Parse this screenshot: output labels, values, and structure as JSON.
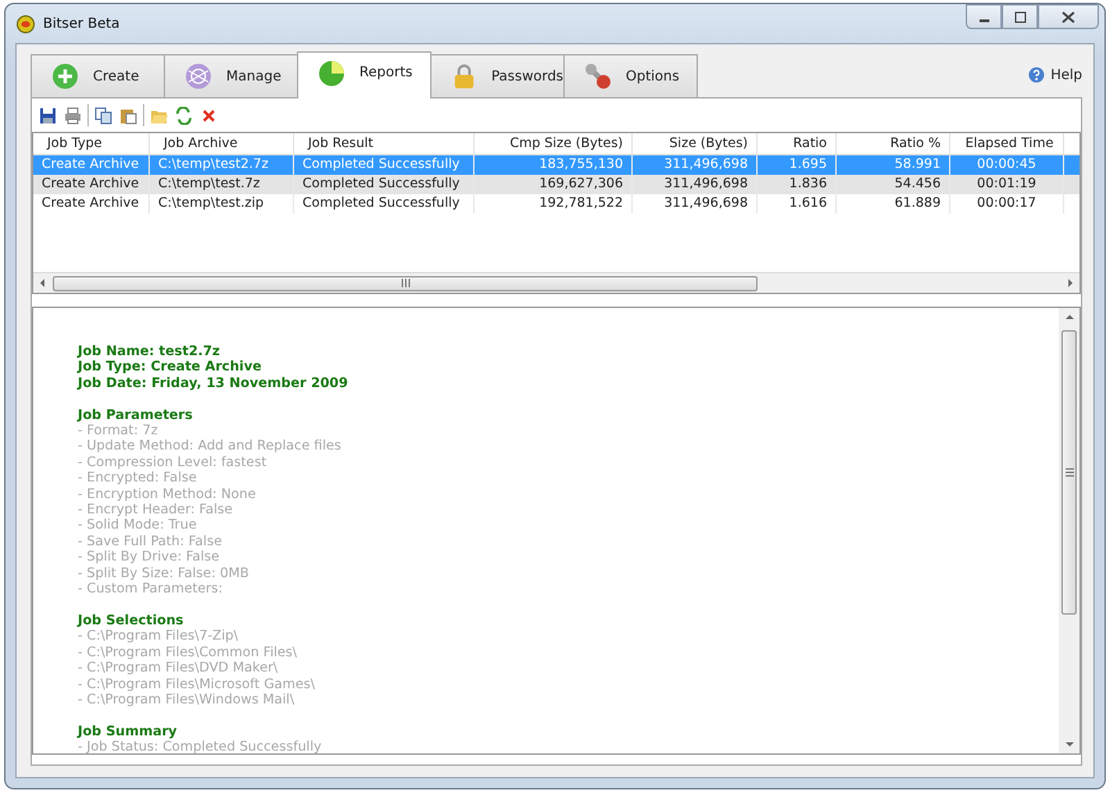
{
  "window": {
    "title": "Bitser Beta"
  },
  "tabs": [
    {
      "label": "Create",
      "selected": false
    },
    {
      "label": "Manage",
      "selected": false
    },
    {
      "label": "Reports",
      "selected": true
    },
    {
      "label": "Passwords",
      "selected": false
    },
    {
      "label": "Options",
      "selected": false
    }
  ],
  "help": {
    "label": "Help"
  },
  "table": {
    "columns": [
      "Job Type",
      "Job Archive",
      "Job Result",
      "Cmp Size (Bytes)",
      "Size (Bytes)",
      "Ratio",
      "Ratio %",
      "Elapsed Time"
    ],
    "rows": [
      {
        "selected": true,
        "hovered": false,
        "cells": [
          "Create Archive",
          "C:\\temp\\test2.7z",
          "Completed Successfully",
          "183,755,130",
          "311,496,698",
          "1.695",
          "58.991",
          "00:00:45"
        ]
      },
      {
        "selected": false,
        "hovered": true,
        "cells": [
          "Create Archive",
          "C:\\temp\\test.7z",
          "Completed Successfully",
          "169,627,306",
          "311,496,698",
          "1.836",
          "54.456",
          "00:01:19"
        ]
      },
      {
        "selected": false,
        "hovered": false,
        "cells": [
          "Create Archive",
          "C:\\temp\\test.zip",
          "Completed Successfully",
          "192,781,522",
          "311,496,698",
          "1.616",
          "61.889",
          "00:00:17"
        ]
      }
    ]
  },
  "report": {
    "header": [
      "Job Name: test2.7z",
      "Job Type: Create Archive",
      "Job Date: Friday, 13 November 2009"
    ],
    "sections": [
      {
        "title": "Job Parameters",
        "items": [
          "- Format: 7z",
          "- Update Method: Add and Replace files",
          "- Compression Level: fastest",
          "- Encrypted: False",
          "- Encryption Method: None",
          "- Encrypt Header: False",
          "- Solid Mode: True",
          "- Save Full Path: False",
          "- Split By Drive: False",
          "- Split By Size: False: 0MB",
          "- Custom Parameters:"
        ]
      },
      {
        "title": "Job Selections",
        "items": [
          "- C:\\Program Files\\7-Zip\\",
          "- C:\\Program Files\\Common Files\\",
          "- C:\\Program Files\\DVD Maker\\",
          "- C:\\Program Files\\Microsoft Games\\",
          "- C:\\Program Files\\Windows Mail\\"
        ]
      },
      {
        "title": "Job Summary",
        "items": [
          "- Job Status: Completed Successfully"
        ]
      }
    ]
  }
}
